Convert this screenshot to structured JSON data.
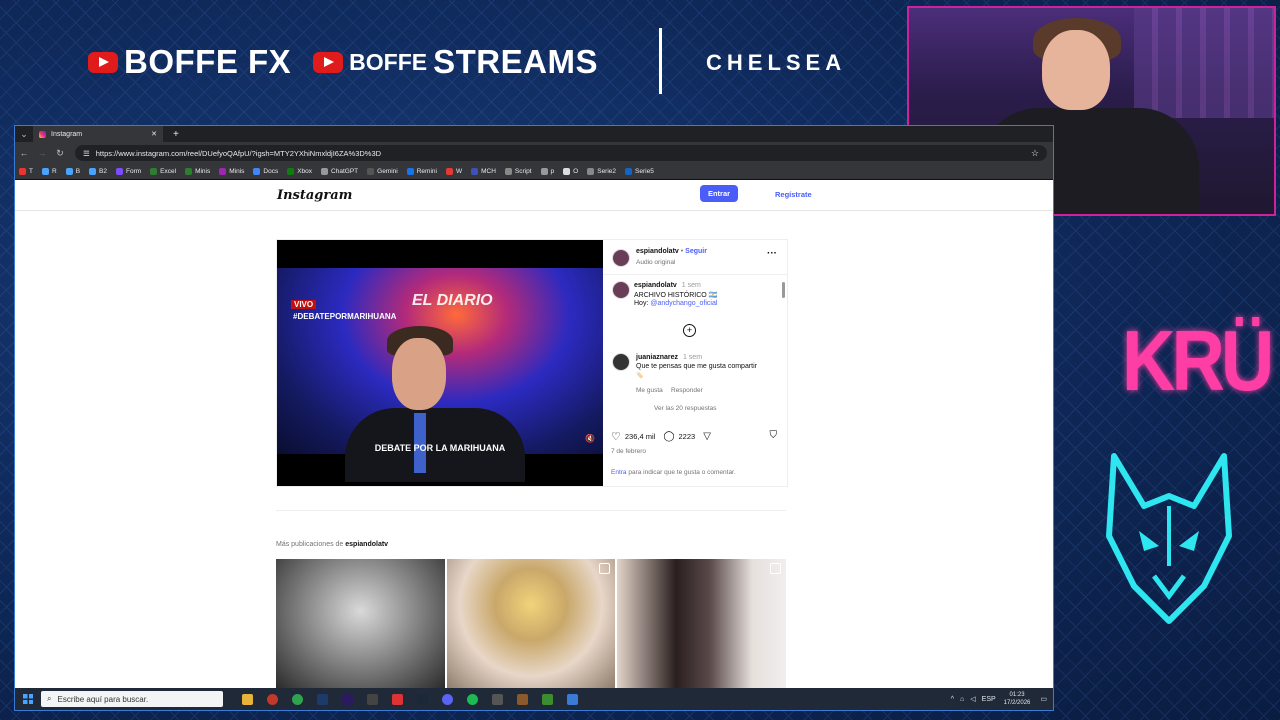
{
  "banner": {
    "brand1": "BOFFE FX",
    "brand2_small": "BOFFE",
    "brand2": "STREAMS",
    "partner": "CHELSEA"
  },
  "right_logo": "KRÜ",
  "browser": {
    "tab_title": "Instagram",
    "url": "https://www.instagram.com/reel/DUefyoQAfpU/?igsh=MTY2YXhiNmxldjI6ZA%3D%3D",
    "bookmarks": [
      "T",
      "R",
      "B",
      "B2",
      "Form",
      "Excel",
      "Minis",
      "Minis",
      "Docs",
      "Xbox",
      "ChatGPT",
      "Gemini",
      "Remini",
      "W",
      "MCH",
      "Script",
      "p",
      "O",
      "Serie2",
      "Serie5"
    ]
  },
  "instagram": {
    "logo": "Instagram",
    "login_label": "Entrar",
    "register_label": "Regístrate",
    "video": {
      "live_tag": "VIVO",
      "show_name": "EL DIARIO",
      "hashtag": "#DEBATEPORMARIHUANA",
      "caption": "DEBATE POR LA MARIHUANA"
    },
    "author": {
      "username": "espiandolatv",
      "separator": "•",
      "follow_label": "Seguir",
      "audio": "Audio original"
    },
    "description": {
      "username": "espiandolatv",
      "time": "1 sem",
      "line1": "ARCHIVO HISTÓRICO 🇦🇷",
      "line2_prefix": "Hoy:",
      "line2_mention": "@andychango_oficial"
    },
    "comment": {
      "username": "juaniaznarez",
      "time": "1 sem",
      "text": "Que te pensas que me gusta compartir",
      "emoji": "🏷️",
      "like_label": "Me gusta",
      "reply_label": "Responder",
      "view_replies": "Ver las 20 respuestas"
    },
    "likes": "236,4 mil",
    "comments": "2223",
    "date": "7 de febrero",
    "login_prompt_link": "Entra",
    "login_prompt_rest": " para indicar que te gusta o comentar.",
    "more_prefix": "Más publicaciones de ",
    "more_user": "espiandolatv"
  },
  "taskbar": {
    "search_placeholder": "Escribe aquí para buscar.",
    "lang": "ESP",
    "time": "01:23",
    "date": "17/2/2026"
  }
}
